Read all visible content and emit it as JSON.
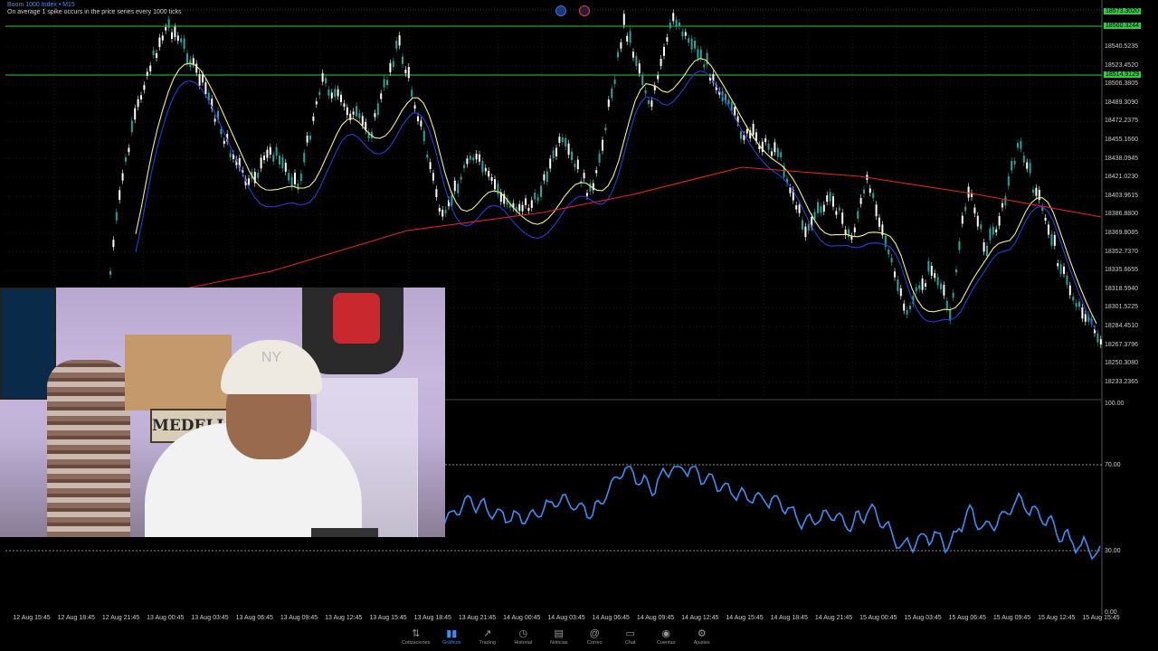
{
  "chart": {
    "symbol": "Boom 1000 Index • M15",
    "info": "On average 1 spike occurs in the price series every 1000 ticks",
    "price_labels": [
      "18540.5235",
      "18523.4520",
      "18506.3805",
      "18489.3090",
      "18472.2375",
      "18455.1660",
      "18438.0945",
      "18421.0230",
      "18403.9615",
      "18386.8800",
      "18369.8085",
      "18352.7370",
      "18335.6655",
      "18318.5940",
      "18301.5225",
      "18284.4510",
      "18267.3796",
      "18250.3080",
      "18233.2365"
    ],
    "top_badge": "18573.3020",
    "green_badge_1": "18560.3244",
    "green_badge_2": "18514.9129",
    "colors": {
      "bull": "#26a69a",
      "bear": "#ffffff",
      "ma_fast": "#f2f27a",
      "ma_mid": "#2a3bd8",
      "ma_slow": "#e02525",
      "level": "#2ecc40",
      "rsi": "#3b8ff5"
    }
  },
  "rsi": {
    "levels": [
      "100.00",
      "70.00",
      "30.00",
      "0.00"
    ]
  },
  "time_axis": [
    "12 Aug 15:45",
    "12 Aug 18:45",
    "12 Aug 21:45",
    "13 Aug 00:45",
    "13 Aug 03:45",
    "13 Aug 06:45",
    "13 Aug 09:45",
    "13 Aug 12:45",
    "13 Aug 15:45",
    "13 Aug 18:45",
    "13 Aug 21:45",
    "14 Aug 00:45",
    "14 Aug 03:45",
    "14 Aug 06:45",
    "14 Aug 09:45",
    "14 Aug 12:45",
    "14 Aug 15:45",
    "14 Aug 18:45",
    "14 Aug 21:45",
    "15 Aug 00:45",
    "15 Aug 03:45",
    "15 Aug 06:45",
    "15 Aug 09:45",
    "15 Aug 12:45",
    "15 Aug 15:45"
  ],
  "webcam": {
    "sign_text": "MEDELLIN"
  },
  "nav": {
    "items": [
      {
        "label": "Cotizaciones",
        "icon": "⇅",
        "icon_name": "quotes-icon"
      },
      {
        "label": "Gráficos",
        "icon": "▮▮",
        "icon_name": "chart-icon"
      },
      {
        "label": "Trading",
        "icon": "↗",
        "icon_name": "trading-icon"
      },
      {
        "label": "Historial",
        "icon": "◷",
        "icon_name": "history-icon"
      },
      {
        "label": "Noticias",
        "icon": "▤",
        "icon_name": "news-icon"
      },
      {
        "label": "Correo",
        "icon": "@",
        "icon_name": "mail-icon"
      },
      {
        "label": "Chat",
        "icon": "▭",
        "icon_name": "chat-icon"
      },
      {
        "label": "Cuentas",
        "icon": "◉",
        "icon_name": "accounts-icon"
      },
      {
        "label": "Ajustes",
        "icon": "⚙",
        "icon_name": "settings-icon"
      }
    ],
    "active_index": 1
  }
}
